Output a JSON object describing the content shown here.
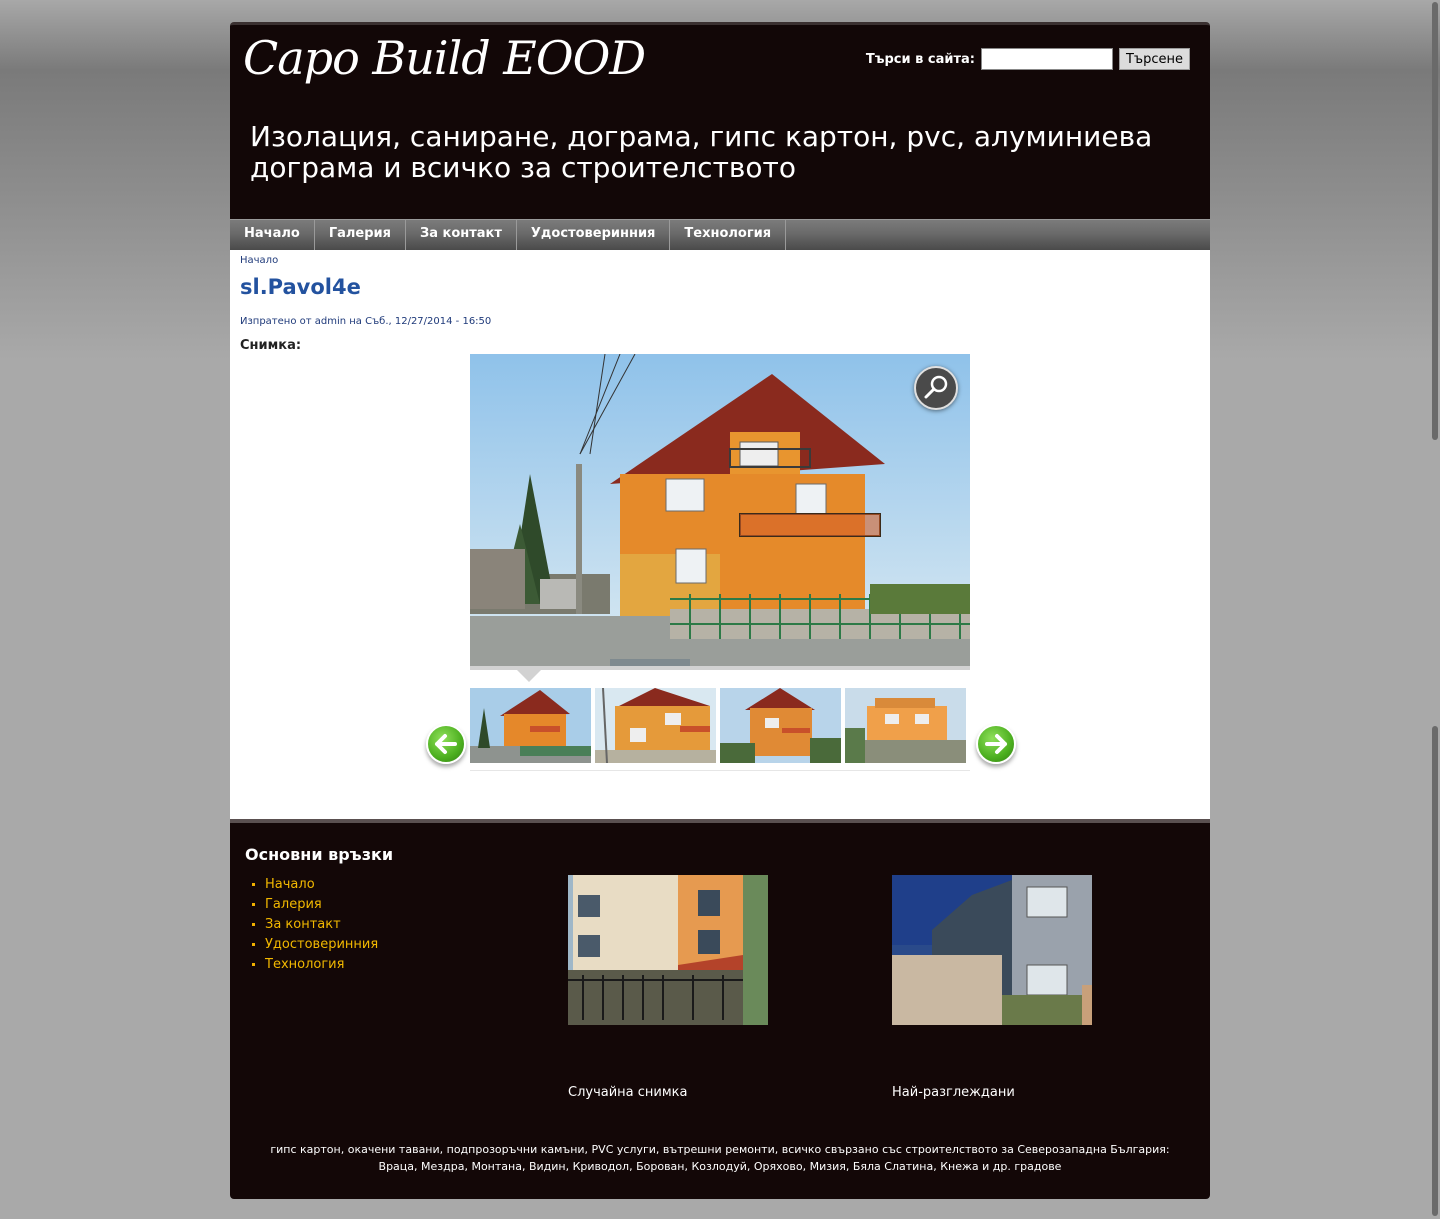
{
  "header": {
    "site_name": "Capo Build  EOOD",
    "slogan": "Изолация, саниране, дограма, гипс картон, pvc, алуминиева дограма и всичко за строителството",
    "search": {
      "label": "Търси в сайта:",
      "value": "",
      "button_label": "Търсене"
    }
  },
  "nav": {
    "items": [
      {
        "label": "Начало"
      },
      {
        "label": "Галерия"
      },
      {
        "label": "За контакт"
      },
      {
        "label": "Удостоверинния"
      },
      {
        "label": "Технология"
      }
    ]
  },
  "content": {
    "breadcrumb": "Начало",
    "title": "sl.Pavol4e",
    "submitted": "Изпратено от admin на Съб., 12/27/2014 - 16:50",
    "field_label": "Снимка:",
    "gallery": {
      "zoom_icon": "magnifier-icon",
      "prev_icon": "arrow-left-icon",
      "next_icon": "arrow-right-icon",
      "thumbnail_count": 4
    }
  },
  "footer": {
    "links_heading": "Основни връзки",
    "links": [
      "Начало",
      "Галерия",
      "За контакт",
      "Удостоверинния",
      "Технология"
    ],
    "random_photo_title": "Случайна снимка",
    "most_viewed_title": "Най-разглеждани",
    "text": "гипс картон, окачени тавани, подпрозоръчни камъни, PVC услуги, вътрешни ремонти, всичко свързано със строителството за Северозападна България: Враца, Мездра, Монтана, Видин, Криводол, Борован, Козлодуй, Оряхово, Мизия, Бяла Слатина, Кнежа и др. градове"
  },
  "colors": {
    "header_bg": "#120707",
    "title_blue": "#23529f",
    "link_yellow": "#f2b800",
    "nav_bg": "#6a6a6a"
  }
}
